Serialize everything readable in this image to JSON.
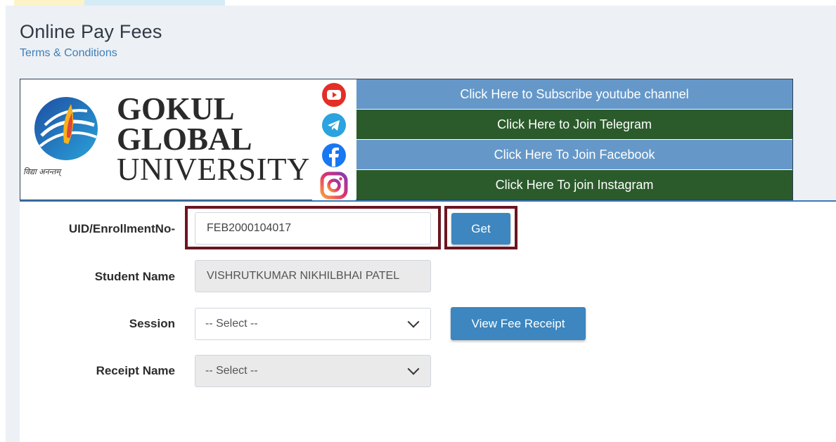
{
  "page": {
    "title": "Online Pay Fees",
    "terms_link": "Terms & Conditions"
  },
  "banner": {
    "logo": {
      "line1": "GOKUL",
      "line2": "GLOBAL",
      "line3": "UNIVERSITY",
      "tagline": "विद्या अनन्तम्"
    },
    "social_links": [
      {
        "icon": "youtube-icon",
        "label": "Click Here to Subscribe youtube channel",
        "color": "#6598c9"
      },
      {
        "icon": "telegram-icon",
        "label": "Click Here to Join Telegram",
        "color": "#2b5b2b"
      },
      {
        "icon": "facebook-icon",
        "label": "Click Here To Join Facebook",
        "color": "#6598c9"
      },
      {
        "icon": "instagram-icon",
        "label": "Click Here To join Instagram",
        "color": "#2b5b2b"
      }
    ]
  },
  "form": {
    "uid_label": "UID/EnrollmentNo-",
    "uid_value": "FEB2000104017",
    "get_button": "Get",
    "student_name_label": "Student Name",
    "student_name_value": "VISHRUTKUMAR NIKHILBHAI PATEL",
    "session_label": "Session",
    "session_value": "-- Select --",
    "view_receipt_button": "View Fee Receipt",
    "receipt_name_label": "Receipt Name",
    "receipt_name_value": "-- Select --"
  },
  "colors": {
    "highlight": "#6b1520",
    "primary_button": "#3d86bf",
    "link": "#3d7fb8"
  }
}
